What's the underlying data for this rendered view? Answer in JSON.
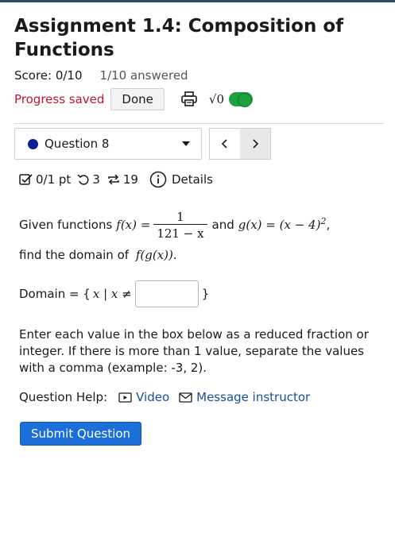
{
  "header": {
    "title": "Assignment 1.4: Composition of Functions",
    "score": "Score: 0/10",
    "answered": "1/10 answered",
    "progress_status": "Progress saved",
    "done_label": "Done",
    "math_toggle_label": "√0"
  },
  "question_nav": {
    "selected": "Question 8",
    "prev": "‹",
    "next": "›"
  },
  "meta": {
    "points": "0/1 pt",
    "retries": "3",
    "attempts": "19",
    "details": "Details"
  },
  "problem": {
    "given": "Given functions",
    "f_lhs": "f(x) =",
    "f_num": "1",
    "f_den": "121 − x",
    "and": "and",
    "g_def": "g(x) = (x − 4)",
    "g_exp": "2",
    "comma": ",",
    "find": "find the domain of",
    "fg": "f(g(x))",
    "period": "."
  },
  "domain": {
    "label": "Domain = {",
    "set_expr": "x | x ≠",
    "close": "}",
    "value": ""
  },
  "instructions": "Enter each value in the box below as a reduced fraction or integer. If there is more than 1 value, separate the values with a comma (example: -3, 2).",
  "help": {
    "label": "Question Help:",
    "video": "Video",
    "message": "Message instructor"
  },
  "submit_label": "Submit Question",
  "colors": {
    "accent": "#1c6fd9",
    "progress": "#c0152a",
    "toggle": "#1fa141",
    "question_dot": "#0b1f99"
  }
}
